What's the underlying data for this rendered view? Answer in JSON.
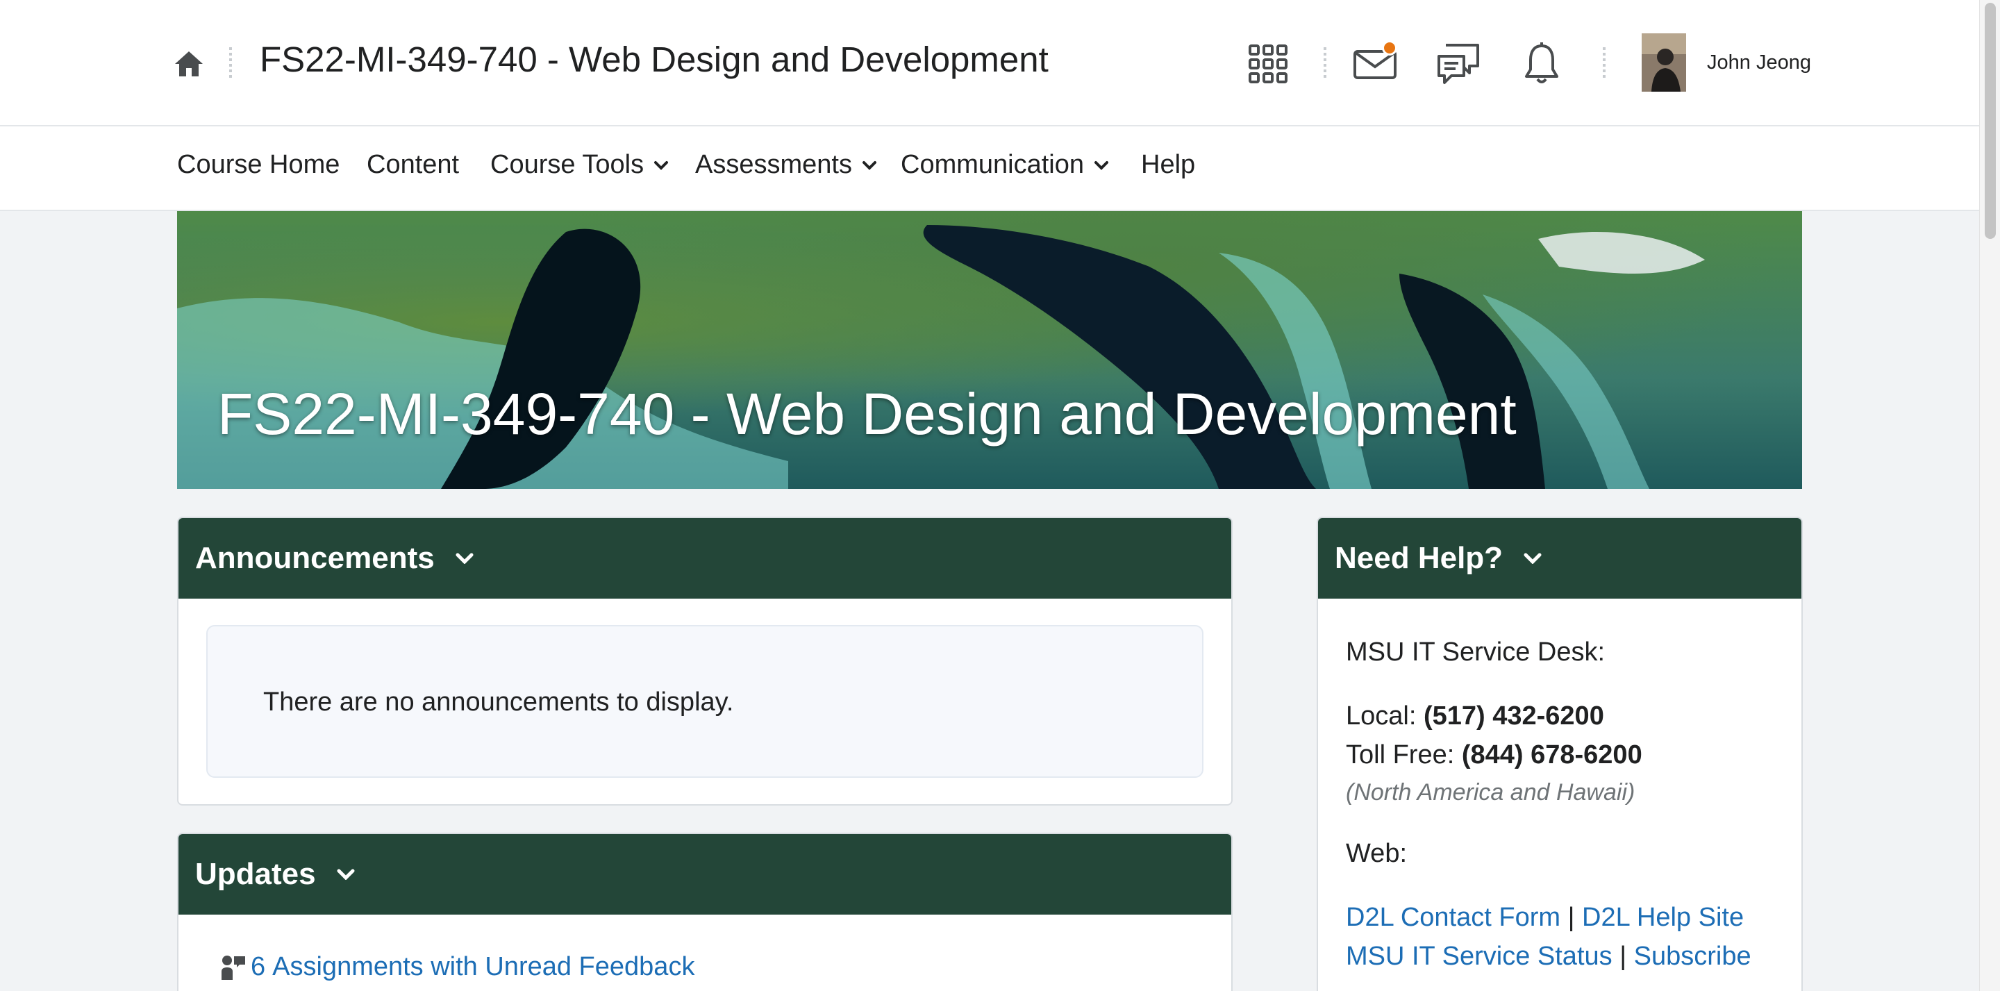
{
  "header": {
    "course_title": "FS22-MI-349-740 - Web Design and Development",
    "user_name": "John Jeong",
    "icons": [
      "home-icon",
      "apps-grid-icon",
      "mail-icon",
      "chat-icon",
      "bell-icon"
    ],
    "notification_badge_color": "#e87511"
  },
  "nav": {
    "items": [
      {
        "label": "Course Home"
      },
      {
        "label": "Content"
      },
      {
        "label": "Course Tools"
      },
      {
        "label": "Assessments"
      },
      {
        "label": "Communication"
      },
      {
        "label": "Help"
      }
    ]
  },
  "banner": {
    "title": "FS22-MI-349-740 - Web Design and Development"
  },
  "announcements": {
    "title": "Announcements",
    "empty_message": "There are no announcements to display."
  },
  "updates": {
    "title": "Updates",
    "item": {
      "count": "6",
      "label": "Assignments with Unread Feedback"
    }
  },
  "help": {
    "title": "Need Help?",
    "desk_label": "MSU IT Service Desk:",
    "local_label": "Local:",
    "local_phone": "(517) 432-6200",
    "tollfree_label": "Toll Free:",
    "tollfree_phone": "(844) 678-6200",
    "region_note": "(North America and Hawaii)",
    "web_label": "Web:",
    "links": {
      "contact_form": "D2L Contact Form",
      "help_site": "D2L Help Site",
      "service_status": "MSU IT Service Status",
      "subscribe": "Subscribe",
      "separator": "|"
    }
  },
  "theme": {
    "widget_header_color": "#234638",
    "link_color": "#1c6db5"
  }
}
